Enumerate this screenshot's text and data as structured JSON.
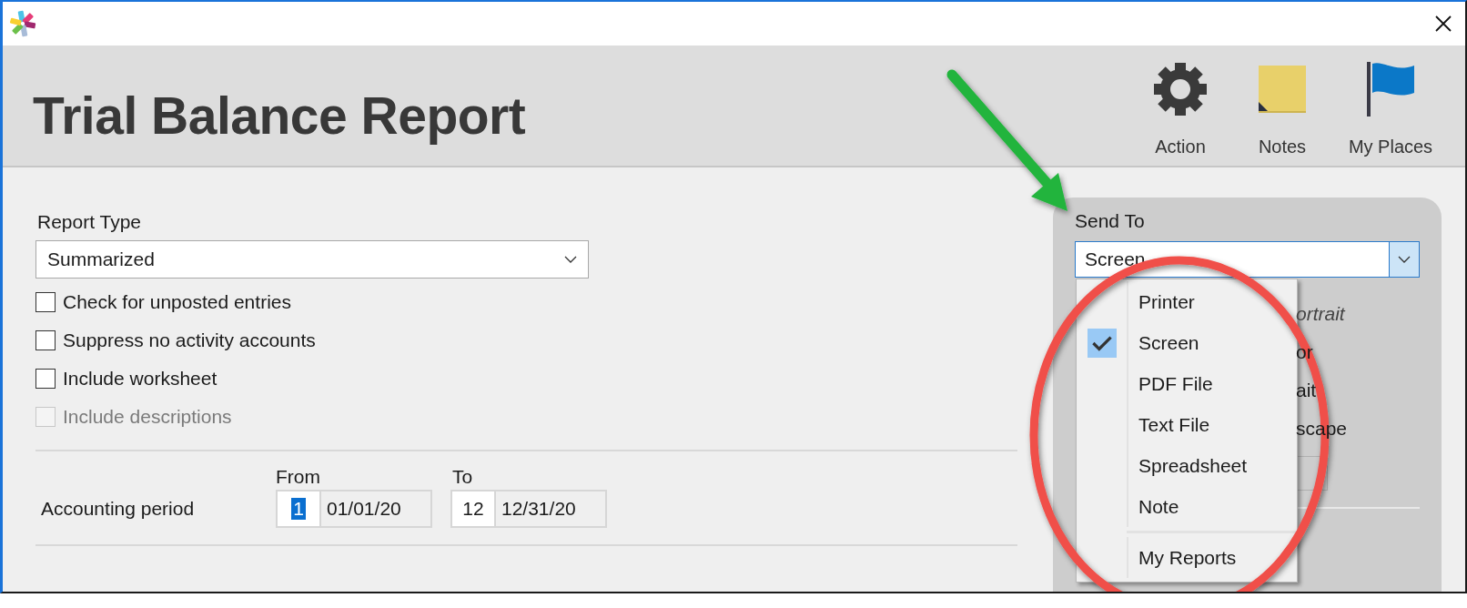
{
  "window": {
    "title": "Trial Balance Report"
  },
  "toolbar": [
    {
      "label": "Action",
      "kind": "gear"
    },
    {
      "label": "Notes",
      "kind": "note"
    },
    {
      "label": "My Places",
      "kind": "flag"
    }
  ],
  "report_type": {
    "label": "Report Type",
    "value": "Summarized"
  },
  "options": [
    {
      "label": "Check for unposted entries",
      "checked": false,
      "disabled": false
    },
    {
      "label": "Suppress no activity accounts",
      "checked": false,
      "disabled": false
    },
    {
      "label": "Include worksheet",
      "checked": false,
      "disabled": false
    },
    {
      "label": "Include descriptions",
      "checked": false,
      "disabled": true
    }
  ],
  "accounting_period": {
    "label": "Accounting period",
    "from_heading": "From",
    "to_heading": "To",
    "from": {
      "period": "1",
      "date": "01/01/20",
      "selected": true
    },
    "to": {
      "period": "12",
      "date": "12/31/20",
      "selected": false
    }
  },
  "send_to": {
    "label": "Send To",
    "value": "Screen",
    "covered_texts": [
      {
        "text": "ortrait",
        "italic": true
      },
      {
        "text": "or",
        "italic": false
      },
      {
        "text": "ait",
        "italic": false
      },
      {
        "text": "scape",
        "italic": false
      }
    ],
    "menu": [
      {
        "label": "Printer",
        "checked": false
      },
      {
        "label": "Screen",
        "checked": true
      },
      {
        "label": "PDF File",
        "checked": false
      },
      {
        "label": "Text File",
        "checked": false
      },
      {
        "label": "Spreadsheet",
        "checked": false
      },
      {
        "label": "Note",
        "checked": false
      }
    ],
    "menu_footer": [
      {
        "label": "My Reports",
        "checked": false
      }
    ]
  }
}
